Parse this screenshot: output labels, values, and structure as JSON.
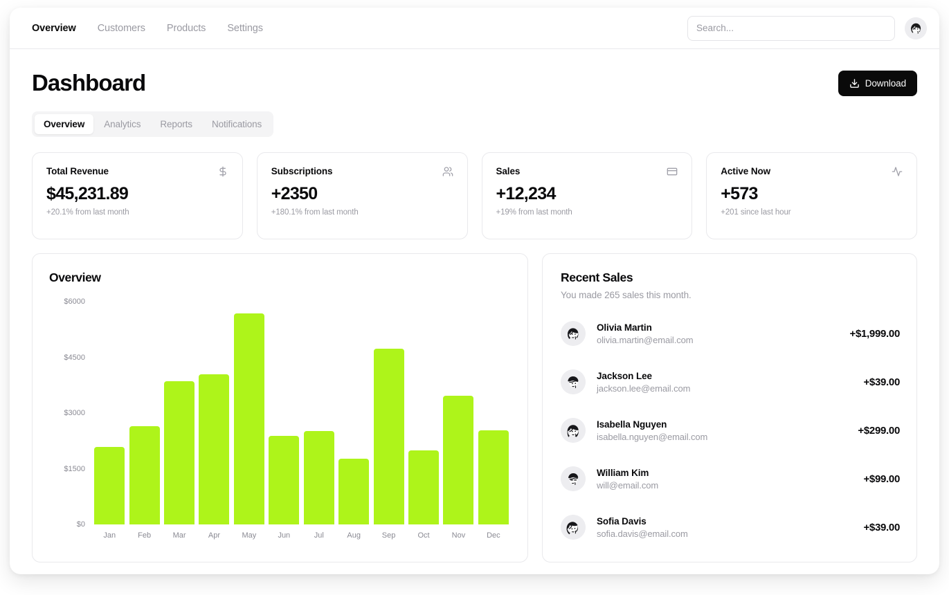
{
  "nav": {
    "links": [
      {
        "label": "Overview",
        "active": true
      },
      {
        "label": "Customers",
        "active": false
      },
      {
        "label": "Products",
        "active": false
      },
      {
        "label": "Settings",
        "active": false
      }
    ],
    "search_placeholder": "Search...",
    "search_value": "",
    "avatar_icon": "user-avatar-icon"
  },
  "header": {
    "title": "Dashboard",
    "download_label": "Download",
    "download_icon": "download-icon"
  },
  "tabs": [
    {
      "label": "Overview",
      "active": true
    },
    {
      "label": "Analytics",
      "active": false
    },
    {
      "label": "Reports",
      "active": false
    },
    {
      "label": "Notifications",
      "active": false
    }
  ],
  "stats": [
    {
      "label": "Total Revenue",
      "value": "$45,231.89",
      "sub": "+20.1% from last month",
      "icon": "dollar-icon"
    },
    {
      "label": "Subscriptions",
      "value": "+2350",
      "sub": "+180.1% from last month",
      "icon": "users-icon"
    },
    {
      "label": "Sales",
      "value": "+12,234",
      "sub": "+19% from last month",
      "icon": "credit-card-icon"
    },
    {
      "label": "Active Now",
      "value": "+573",
      "sub": "+201 since last hour",
      "icon": "activity-icon"
    }
  ],
  "overview_panel": {
    "title": "Overview"
  },
  "chart_data": {
    "type": "bar",
    "title": "Overview",
    "xlabel": "",
    "ylabel": "",
    "ylim": [
      0,
      6000
    ],
    "grid": false,
    "legend": null,
    "bar_color": "#aef41a",
    "ytick_labels": [
      "$6000",
      "$4500",
      "$3000",
      "$1500",
      "$0"
    ],
    "ytick_values": [
      6000,
      4500,
      3000,
      1500,
      0
    ],
    "categories": [
      "Jan",
      "Feb",
      "Mar",
      "Apr",
      "May",
      "Jun",
      "Jul",
      "Aug",
      "Sep",
      "Oct",
      "Nov",
      "Dec"
    ],
    "values": [
      2090,
      2655,
      3855,
      4050,
      5680,
      2385,
      2520,
      1765,
      4730,
      1995,
      3470,
      2540
    ]
  },
  "recent_sales": {
    "title": "Recent Sales",
    "subtitle": "You made 265 sales this month.",
    "rows": [
      {
        "name": "Olivia Martin",
        "email": "olivia.martin@email.com",
        "amount": "+$1,999.00",
        "avatar_icon": "avatar-olivia-icon"
      },
      {
        "name": "Jackson Lee",
        "email": "jackson.lee@email.com",
        "amount": "+$39.00",
        "avatar_icon": "avatar-jackson-icon"
      },
      {
        "name": "Isabella Nguyen",
        "email": "isabella.nguyen@email.com",
        "amount": "+$299.00",
        "avatar_icon": "avatar-isabella-icon"
      },
      {
        "name": "William Kim",
        "email": "will@email.com",
        "amount": "+$99.00",
        "avatar_icon": "avatar-william-icon"
      },
      {
        "name": "Sofia Davis",
        "email": "sofia.davis@email.com",
        "amount": "+$39.00",
        "avatar_icon": "avatar-sofia-icon"
      }
    ]
  }
}
